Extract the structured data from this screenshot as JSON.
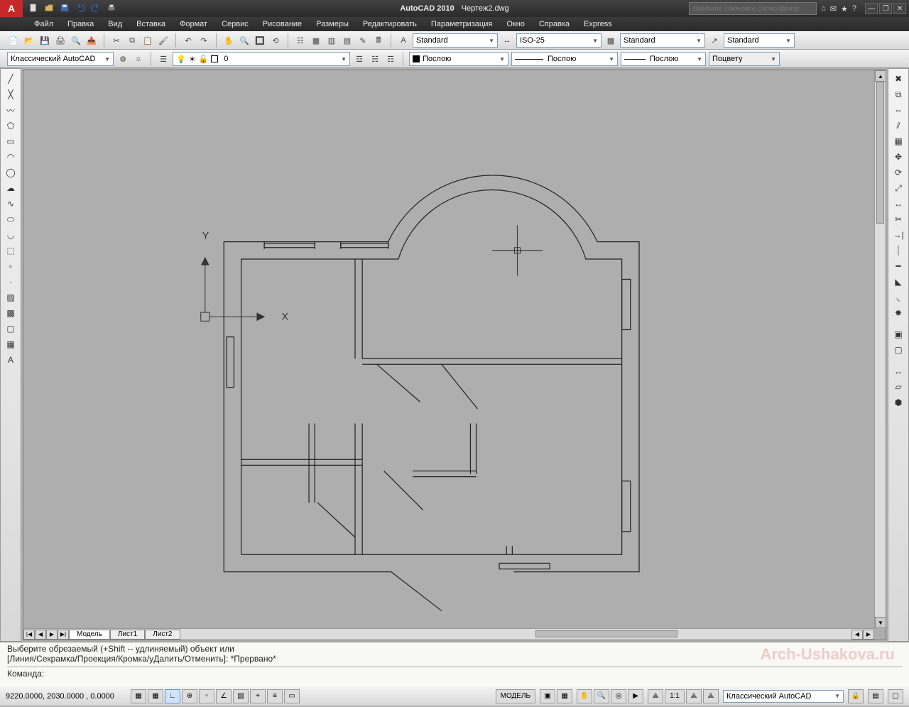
{
  "title": {
    "app": "AutoCAD 2010",
    "file": "Чертеж2.dwg"
  },
  "search": {
    "placeholder": "Введите ключевое слово/фразу"
  },
  "menus": [
    "Файл",
    "Правка",
    "Вид",
    "Вставка",
    "Формат",
    "Сервис",
    "Рисование",
    "Размеры",
    "Редактировать",
    "Параметризация",
    "Окно",
    "Справка",
    "Express"
  ],
  "toolbar1": {
    "text_style": "Standard",
    "dim_style": "ISO-25",
    "table_style": "Standard",
    "mleader_style": "Standard"
  },
  "toolbar2": {
    "workspace": "Классический AutoCAD",
    "layer": "0",
    "color": "Послою",
    "linetype": "Послою",
    "lineweight": "Послою",
    "plotstyle": "Поцвету"
  },
  "sheets": {
    "tabs": [
      "Модель",
      "Лист1",
      "Лист2"
    ],
    "active": 0
  },
  "axis": {
    "x": "X",
    "y": "Y"
  },
  "command": {
    "history1": "Выберите обрезаемый (+Shift -- удлиняемый) объект или",
    "history2": "[Линия/Секрамка/Проекция/Кромка/уДалить/Отменить]: *Прервано*",
    "prompt": "Команда:",
    "watermark": "Arch-Ushakova.ru"
  },
  "status": {
    "coords": "9220.0000, 2030.0000 , 0.0000",
    "model": "МОДЕЛЬ",
    "scale": "1:1",
    "workspace": "Классический AutoCAD"
  }
}
